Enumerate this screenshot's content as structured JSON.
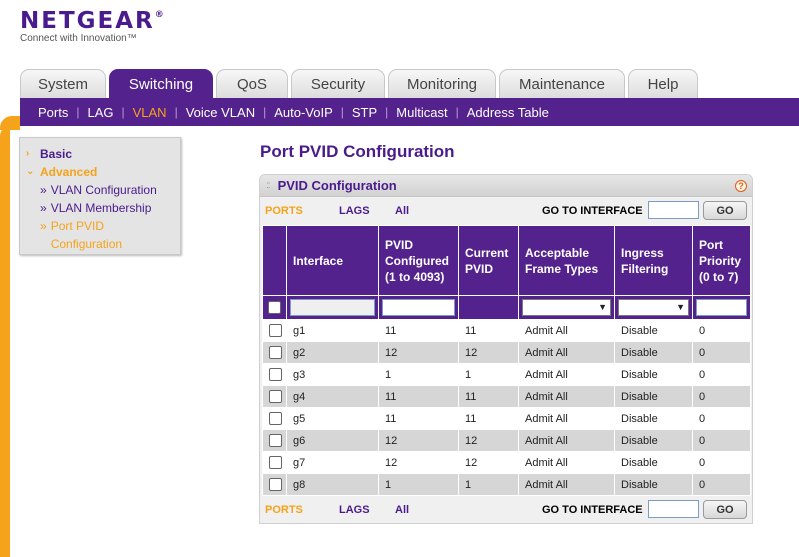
{
  "brand": {
    "name": "NETGEAR",
    "trademark": "®",
    "tagline": "Connect with Innovation™"
  },
  "main_tabs": [
    {
      "label": "System",
      "active": false
    },
    {
      "label": "Switching",
      "active": true
    },
    {
      "label": "QoS",
      "active": false
    },
    {
      "label": "Security",
      "active": false
    },
    {
      "label": "Monitoring",
      "active": false
    },
    {
      "label": "Maintenance",
      "active": false
    },
    {
      "label": "Help",
      "active": false
    }
  ],
  "sub_tabs": [
    {
      "label": "Ports",
      "active": false
    },
    {
      "label": "LAG",
      "active": false
    },
    {
      "label": "VLAN",
      "active": true
    },
    {
      "label": "Voice VLAN",
      "active": false
    },
    {
      "label": "Auto-VoIP",
      "active": false
    },
    {
      "label": "STP",
      "active": false
    },
    {
      "label": "Multicast",
      "active": false
    },
    {
      "label": "Address Table",
      "active": false
    }
  ],
  "sidebar": {
    "basic": "Basic",
    "advanced": "Advanced",
    "items": [
      {
        "label": "VLAN Configuration",
        "active": false
      },
      {
        "label": "VLAN Membership",
        "active": false
      },
      {
        "label": "Port PVID Configuration",
        "active": true
      }
    ]
  },
  "page": {
    "title": "Port PVID Configuration"
  },
  "panel": {
    "title": "PVID Configuration",
    "help": "?",
    "nav": {
      "ports": "PORTS",
      "lags": "LAGS",
      "all": "All",
      "goto_label": "GO TO INTERFACE",
      "goto_value": "",
      "go_button": "GO"
    },
    "columns": [
      "Interface",
      "PVID Configured (1 to 4093)",
      "Current PVID",
      "Acceptable Frame Types",
      "Ingress Filtering",
      "Port Priority (0 to 7)"
    ],
    "rows": [
      {
        "interface": "g1",
        "pvid_configured": "11",
        "current_pvid": "11",
        "frame_types": "Admit All",
        "ingress": "Disable",
        "priority": "0"
      },
      {
        "interface": "g2",
        "pvid_configured": "12",
        "current_pvid": "12",
        "frame_types": "Admit All",
        "ingress": "Disable",
        "priority": "0"
      },
      {
        "interface": "g3",
        "pvid_configured": "1",
        "current_pvid": "1",
        "frame_types": "Admit All",
        "ingress": "Disable",
        "priority": "0"
      },
      {
        "interface": "g4",
        "pvid_configured": "11",
        "current_pvid": "11",
        "frame_types": "Admit All",
        "ingress": "Disable",
        "priority": "0"
      },
      {
        "interface": "g5",
        "pvid_configured": "11",
        "current_pvid": "11",
        "frame_types": "Admit All",
        "ingress": "Disable",
        "priority": "0"
      },
      {
        "interface": "g6",
        "pvid_configured": "12",
        "current_pvid": "12",
        "frame_types": "Admit All",
        "ingress": "Disable",
        "priority": "0"
      },
      {
        "interface": "g7",
        "pvid_configured": "12",
        "current_pvid": "12",
        "frame_types": "Admit All",
        "ingress": "Disable",
        "priority": "0"
      },
      {
        "interface": "g8",
        "pvid_configured": "1",
        "current_pvid": "1",
        "frame_types": "Admit All",
        "ingress": "Disable",
        "priority": "0"
      }
    ]
  },
  "colors": {
    "brand_purple": "#54228c",
    "accent_orange": "#f5a31a",
    "row_alt": "#d6d6d6"
  }
}
